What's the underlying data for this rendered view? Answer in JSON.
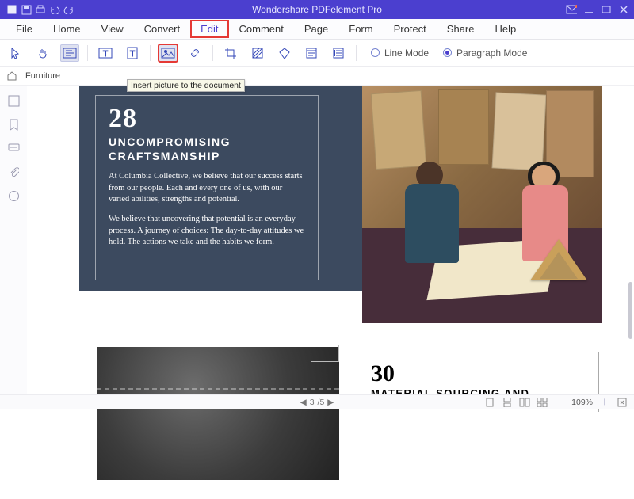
{
  "app": {
    "title": "Wondershare PDFelement Pro"
  },
  "menu": {
    "items": [
      "File",
      "Home",
      "View",
      "Convert",
      "Edit",
      "Comment",
      "Page",
      "Form",
      "Protect",
      "Share",
      "Help"
    ],
    "active_index": 4
  },
  "toolbar": {
    "tooltip": "Insert picture to the document",
    "modes": {
      "line": "Line Mode",
      "paragraph": "Paragraph Mode",
      "selected": "paragraph"
    },
    "tools": [
      "select",
      "hand",
      "edit-region",
      "text-horiz",
      "text-vert",
      "image",
      "link",
      "crop",
      "opacity",
      "shape",
      "list-ordered",
      "list-unordered"
    ]
  },
  "breadcrumb": {
    "doc_name": "Furniture"
  },
  "leftrail": [
    "page-thumb",
    "bookmark",
    "comment-list",
    "attachment",
    "annotation"
  ],
  "document": {
    "block28": {
      "number": "28",
      "heading": "UNCOMPROMISING CRAFTSMANSHIP",
      "para1": "At Columbia Collective, we believe that our success starts from our people. Each and every one of us, with our varied abilities, strengths and potential.",
      "para2": "We believe that uncovering that potential is an everyday process. A journey of choices: The day-to-day attitudes we hold. The actions we take and the habits we form."
    },
    "block30": {
      "number": "30",
      "heading": "MATERIAL SOURCING AND TREATMENT"
    }
  },
  "status": {
    "page_current": "3",
    "page_total": "/5",
    "zoom": "109%"
  }
}
